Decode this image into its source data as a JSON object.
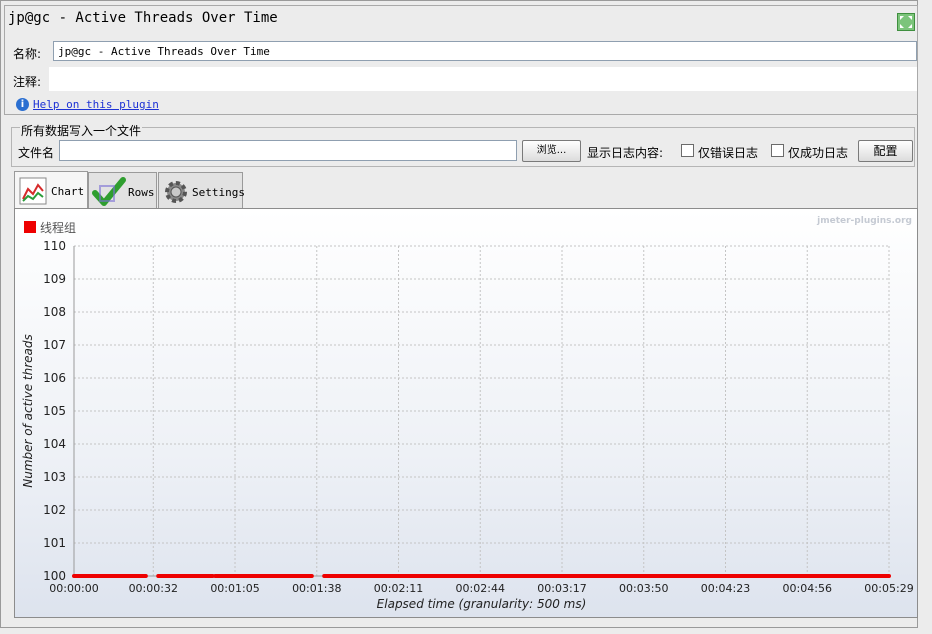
{
  "header": {
    "title": "jp@gc - Active Threads Over Time",
    "name_label": "名称:",
    "name_value": "jp@gc - Active Threads Over Time",
    "comment_label": "注释:",
    "help_link": "Help on this plugin"
  },
  "file": {
    "group_title": "所有数据写入一个文件",
    "filename_label": "文件名",
    "browse_button": "浏览...",
    "log_display_label": "显示日志内容:",
    "errors_only_label": "仅错误日志",
    "success_only_label": "仅成功日志",
    "config_button": "配置",
    "errors_only_checked": false,
    "success_only_checked": false
  },
  "tabs": [
    {
      "label": "Chart",
      "icon": "chart-icon",
      "active": true
    },
    {
      "label": "Rows",
      "icon": "checkmark-icon",
      "active": false
    },
    {
      "label": "Settings",
      "icon": "gear-icon",
      "active": false
    }
  ],
  "chart_data": {
    "type": "line",
    "watermark": "jmeter-plugins.org",
    "legend": [
      {
        "name": "线程组",
        "color": "#ee0000"
      }
    ],
    "legend_position": "top-left",
    "ylabel": "Number of active threads",
    "xlabel": "Elapsed time (granularity: 500 ms)",
    "ylim": [
      100,
      110
    ],
    "yticks": [
      100,
      101,
      102,
      103,
      104,
      105,
      106,
      107,
      108,
      109,
      110
    ],
    "xticks": [
      "00:00:00",
      "00:00:32",
      "00:01:05",
      "00:01:38",
      "00:02:11",
      "00:02:44",
      "00:03:17",
      "00:03:50",
      "00:04:23",
      "00:04:56",
      "00:05:29"
    ],
    "xlim_seconds": [
      0,
      329
    ],
    "grid": true,
    "series": [
      {
        "name": "线程组",
        "color": "#ee0000",
        "segments": [
          {
            "x_start": "00:00:00",
            "x_end": "00:00:29",
            "y": 100
          },
          {
            "x_start": "00:00:34",
            "x_end": "00:00:56",
            "y": 100
          },
          {
            "x_start": "00:00:57",
            "x_end": "00:01:36",
            "y": 100
          },
          {
            "x_start": "00:01:41",
            "x_end": "00:05:29",
            "y": 100
          }
        ]
      }
    ]
  }
}
